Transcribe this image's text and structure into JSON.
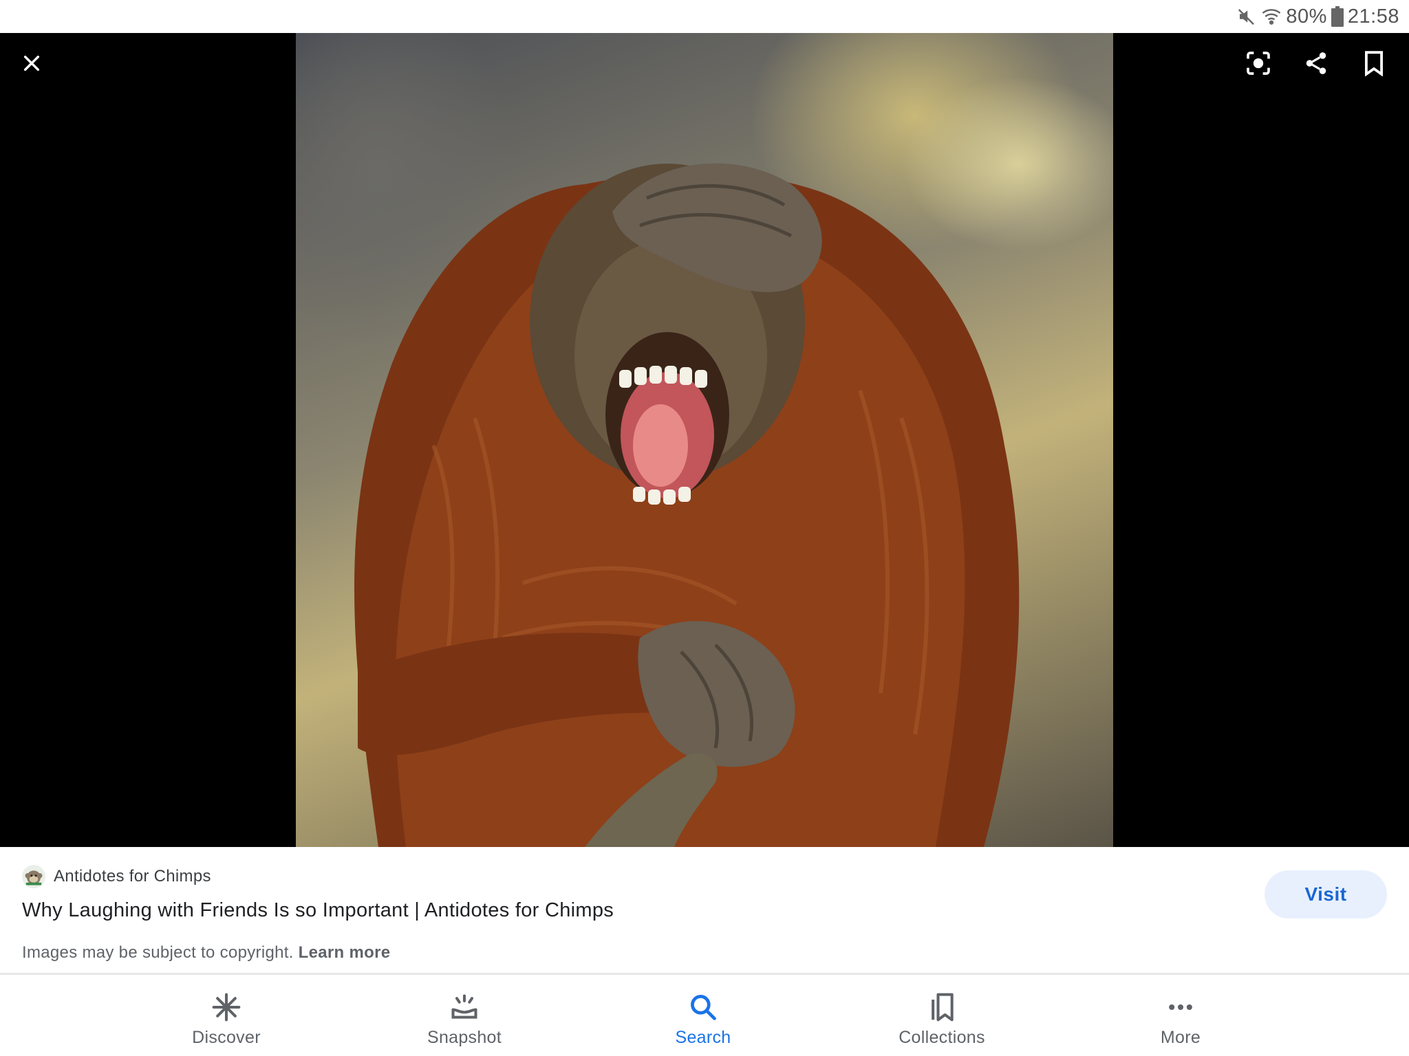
{
  "status_bar": {
    "battery": "80%",
    "time": "21:58",
    "icons": [
      "mute-icon",
      "wifi-icon",
      "battery-icon"
    ]
  },
  "viewer": {
    "icons": [
      "close-icon",
      "lens-icon",
      "share-icon",
      "bookmark-icon"
    ],
    "image_subject": "orangutan"
  },
  "result": {
    "source_name": "Antidotes for Chimps",
    "title": "Why Laughing with Friends Is so Important | Antidotes for Chimps",
    "copyright_text": "Images may be subject to copyright.",
    "learn_more": "Learn more",
    "visit_label": "Visit"
  },
  "nav": {
    "items": [
      {
        "label": "Discover",
        "icon": "asterisk-icon"
      },
      {
        "label": "Snapshot",
        "icon": "snapshot-icon"
      },
      {
        "label": "Search",
        "icon": "search-icon"
      },
      {
        "label": "Collections",
        "icon": "collections-icon"
      },
      {
        "label": "More",
        "icon": "more-icon"
      }
    ],
    "active": "Search"
  },
  "colors": {
    "accent": "#1a73e8",
    "visit_bg": "#e8f0fe",
    "text_primary": "#202124",
    "text_secondary": "#5f6368"
  }
}
